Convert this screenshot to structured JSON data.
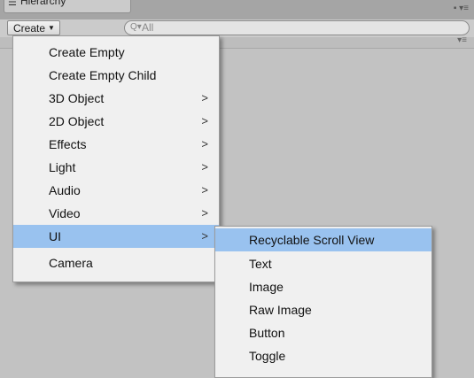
{
  "window": {
    "tab_icon": "hamburger-icon",
    "tab_title": "Hierarchy",
    "options_icon": "lock-and-menu-icon"
  },
  "toolbar": {
    "create_label": "Create",
    "search_placeholder": "All"
  },
  "menu": {
    "items": [
      {
        "label": "Create Empty",
        "submenu": false
      },
      {
        "label": "Create Empty Child",
        "submenu": false
      },
      {
        "label": "3D Object",
        "submenu": true
      },
      {
        "label": "2D Object",
        "submenu": true
      },
      {
        "label": "Effects",
        "submenu": true
      },
      {
        "label": "Light",
        "submenu": true
      },
      {
        "label": "Audio",
        "submenu": true
      },
      {
        "label": "Video",
        "submenu": true
      },
      {
        "label": "UI",
        "submenu": true,
        "selected": true
      },
      {
        "label": "Camera",
        "submenu": false
      }
    ],
    "arrow_glyph": ">"
  },
  "submenu": {
    "items": [
      {
        "label": "Recyclable Scroll View",
        "selected": true
      },
      {
        "label": "Text"
      },
      {
        "label": "Image"
      },
      {
        "label": "Raw Image"
      },
      {
        "label": "Button"
      },
      {
        "label": "Toggle"
      }
    ]
  },
  "colors": {
    "highlight": "#99c2ef",
    "menu_bg": "#f0f0f0",
    "panel_bg": "#c2c2c2"
  }
}
